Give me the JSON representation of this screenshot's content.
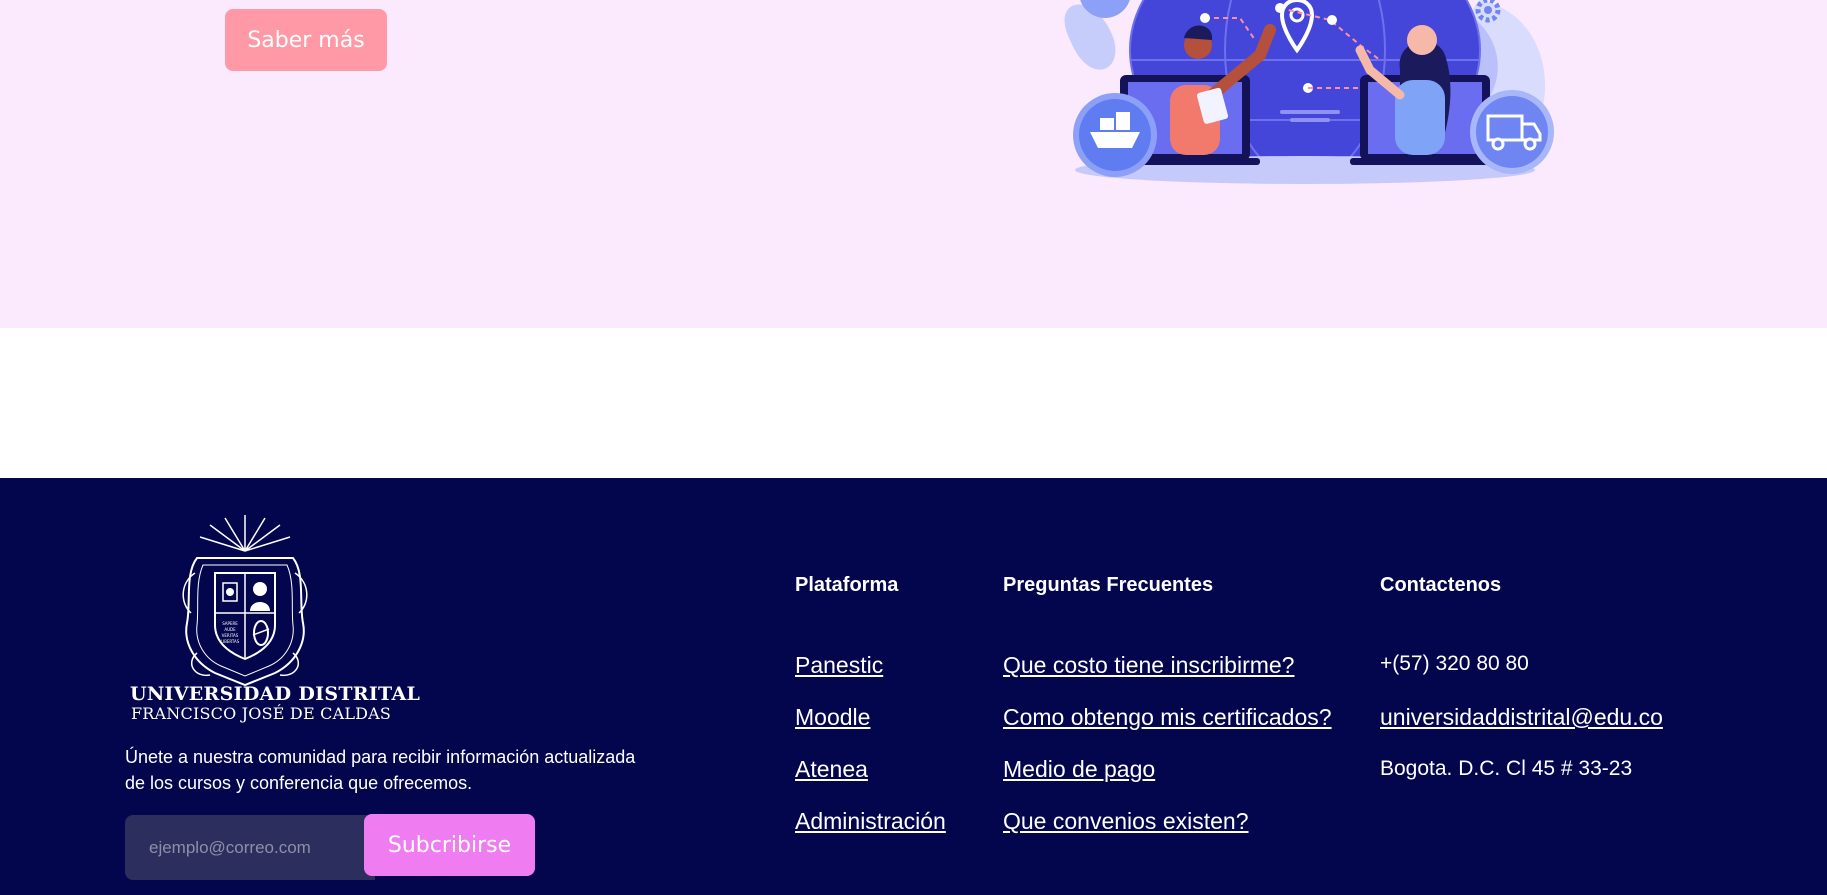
{
  "hero": {
    "cta_label": "Saber más"
  },
  "footer": {
    "logo": {
      "name_line1": "UNIVERSIDAD DISTRITAL",
      "name_line2": "FRANCISCO JOSÉ DE CALDAS",
      "seal_text": [
        "SAPERE",
        "AUDE",
        "VERITAS",
        "LIBERTAS"
      ]
    },
    "newsletter": {
      "text": "Únete a nuestra comunidad para recibir información actualizada de los cursos y conferencia que ofrecemos.",
      "email_placeholder": "ejemplo@correo.com",
      "subscribe_label": "Subcribirse"
    },
    "plataforma": {
      "title": "Plataforma",
      "links": [
        "Panestic",
        "Moodle",
        "Atenea",
        "Administración"
      ]
    },
    "faq": {
      "title": "Preguntas Frecuentes",
      "links": [
        "Que costo tiene inscribirme?",
        "Como obtengo mis certificados?",
        "Medio de pago",
        "Que convenios existen?"
      ]
    },
    "contact": {
      "title": "Contactenos",
      "phone": "+(57) 320 80 80",
      "email": "universidaddistrital@edu.co",
      "address": "Bogota. D.C. Cl 45 # 33-23"
    }
  },
  "colors": {
    "hero_bg": "#fbeafd",
    "footer_bg": "#03064d",
    "cta": "#ff99a6",
    "subscribe": "#f07cf2"
  },
  "icons": [
    "ship-icon",
    "truck-icon",
    "location-pin-icon",
    "gear-icon"
  ]
}
